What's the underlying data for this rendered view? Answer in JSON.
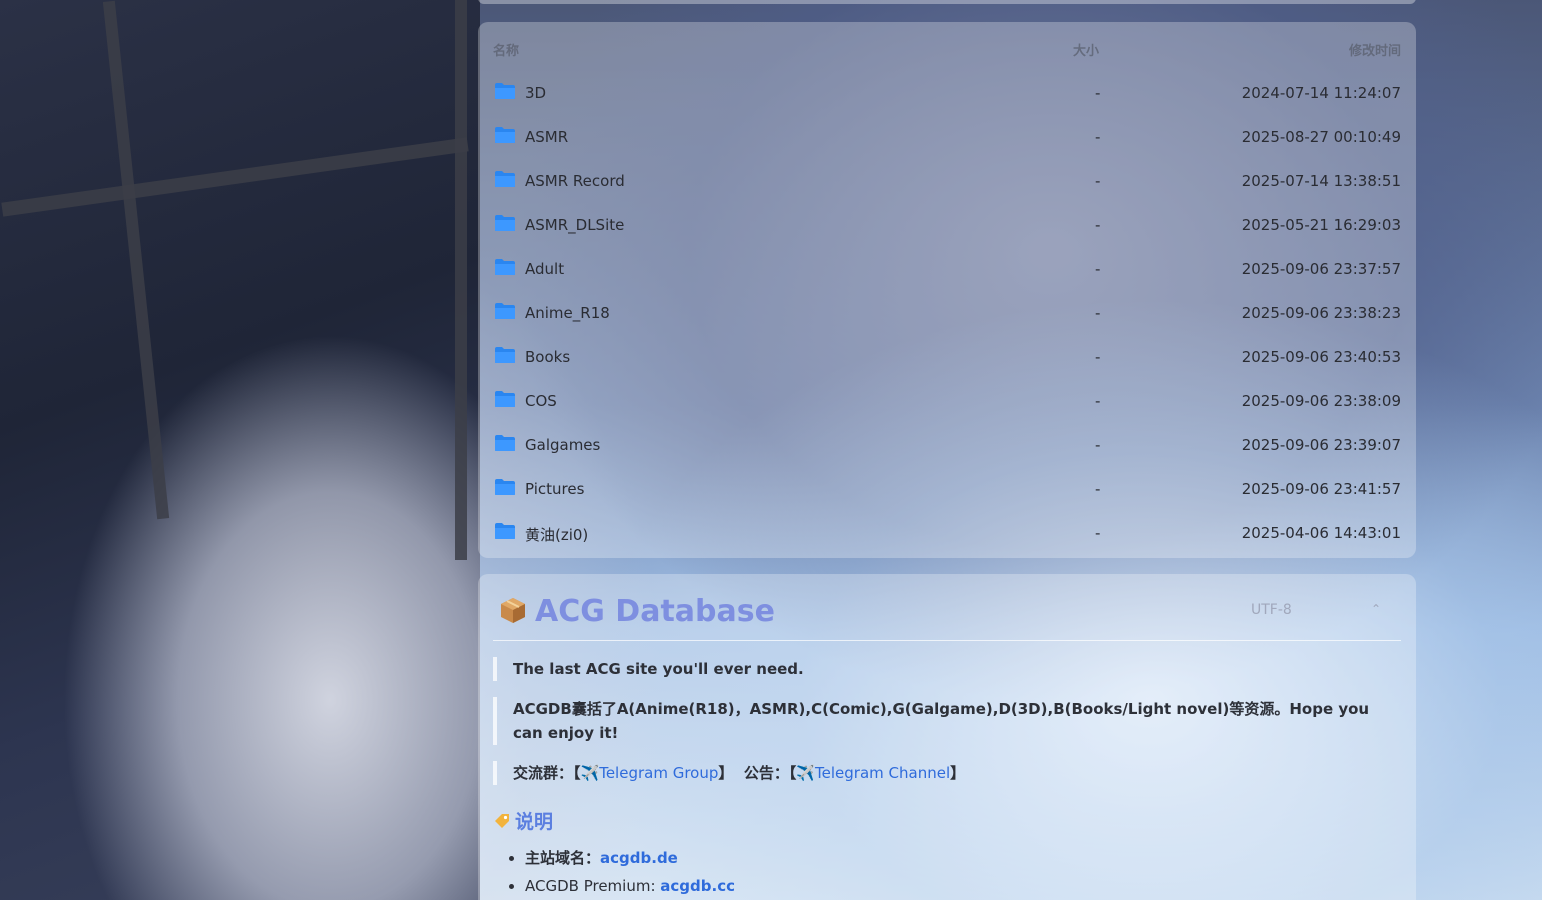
{
  "files": {
    "headers": {
      "name": "名称",
      "size": "大小",
      "modified": "修改时间"
    },
    "rows": [
      {
        "name": "3D",
        "size": "-",
        "modified": "2024-07-14 11:24:07"
      },
      {
        "name": "ASMR",
        "size": "-",
        "modified": "2025-08-27 00:10:49"
      },
      {
        "name": "ASMR Record",
        "size": "-",
        "modified": "2025-07-14 13:38:51"
      },
      {
        "name": "ASMR_DLSite",
        "size": "-",
        "modified": "2025-05-21 16:29:03"
      },
      {
        "name": "Adult",
        "size": "-",
        "modified": "2025-09-06 23:37:57"
      },
      {
        "name": "Anime_R18",
        "size": "-",
        "modified": "2025-09-06 23:38:23"
      },
      {
        "name": "Books",
        "size": "-",
        "modified": "2025-09-06 23:40:53"
      },
      {
        "name": "COS",
        "size": "-",
        "modified": "2025-09-06 23:38:09"
      },
      {
        "name": "Galgames",
        "size": "-",
        "modified": "2025-09-06 23:39:07"
      },
      {
        "name": "Pictures",
        "size": "-",
        "modified": "2025-09-06 23:41:57"
      },
      {
        "name": "黄油(zi0)",
        "size": "-",
        "modified": "2025-04-06 14:43:01"
      }
    ],
    "folder_icon": "folder-icon",
    "folder_color": "#2a86f0"
  },
  "readme": {
    "title": "ACG Database",
    "title_icon": "package-icon",
    "encoding": "UTF-8",
    "quote1": "The last ACG site you'll ever need.",
    "quote2": "ACGDB囊括了A(Anime(R18)，ASMR),C(Comic),G(Galgame),D(3D),B(Books/Light novel)等资源。Hope you can enjoy it!",
    "quote3": {
      "group_label": "交流群：【",
      "group_link": "Telegram Group",
      "group_close": "】",
      "notice_label": "公告：【",
      "notice_link": "Telegram Channel",
      "notice_close": "】"
    },
    "section_title": "说明",
    "section_icon": "tag-icon",
    "list": [
      {
        "label": "主站域名：",
        "link": "acgdb.de"
      },
      {
        "label": "ACGDB Premium: ",
        "link": "acgdb.cc"
      }
    ],
    "accent_color": "#7e8fe0",
    "link_color": "#2f6bdb"
  }
}
